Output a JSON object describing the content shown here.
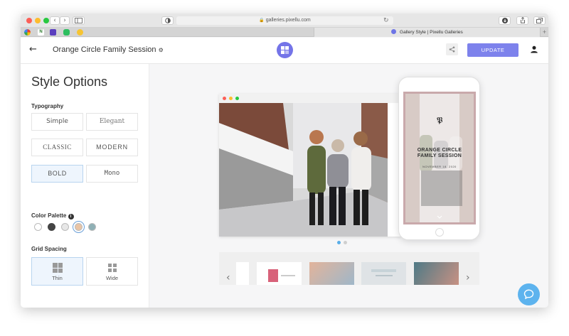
{
  "browser": {
    "url": "galleries.pixellu.com",
    "active_tab_title": "Gallery Style | Pixellu Galleries",
    "back_glyph": "‹",
    "forward_glyph": "›",
    "new_tab_glyph": "+"
  },
  "header": {
    "back_glyph": "←",
    "gallery_title": "Orange Circle Family Session",
    "update_label": "UPDATE"
  },
  "style_options": {
    "title": "Style Options",
    "typography_label": "Typography",
    "typography": [
      "Simple",
      "Elegant",
      "CLASSIC",
      "MODERN",
      "BOLD",
      "Mono"
    ],
    "typography_selected": "BOLD",
    "color_palette_label": "Color Palette",
    "colors": [
      "#ffffff",
      "#444444",
      "#e7e7e7",
      "#e9c4a5",
      "#8fb0b5"
    ],
    "color_selected": 3,
    "grid_spacing_label": "Grid Spacing",
    "grid_spacing": [
      "Thin",
      "Wide"
    ],
    "grid_spacing_selected": "Thin"
  },
  "preview": {
    "cover_title": "ORANGE CIRCLE FAMILY SESSION",
    "cover_date": "NOVEMBER 18, 2020",
    "monogram": "𝕻"
  },
  "colors": {
    "accent": "#7d82ec",
    "chat": "#5db3ee"
  }
}
